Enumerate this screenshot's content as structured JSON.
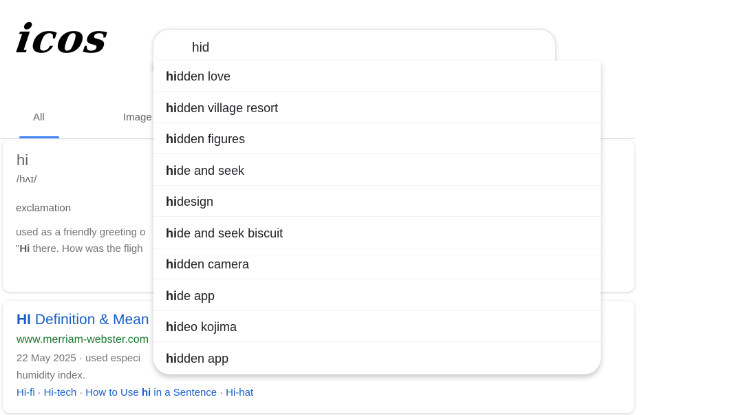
{
  "logo": {
    "text": "icos"
  },
  "search": {
    "value": "hid"
  },
  "tabs": [
    {
      "label": "All"
    },
    {
      "label": "Image"
    }
  ],
  "suggestions": [
    {
      "bold": "hi",
      "rest": "dden love"
    },
    {
      "bold": "hi",
      "rest": "dden village resort"
    },
    {
      "bold": "hi",
      "rest": "dden figures"
    },
    {
      "bold": "hi",
      "rest": "de and seek"
    },
    {
      "bold": "hi",
      "rest": "design"
    },
    {
      "bold": "hi",
      "rest": "de and seek biscuit"
    },
    {
      "bold": "hi",
      "rest": "dden camera"
    },
    {
      "bold": "hi",
      "rest": "de app"
    },
    {
      "bold": "hi",
      "rest": "deo kojima"
    },
    {
      "bold": "hi",
      "rest": "dden app"
    }
  ],
  "dictionary": {
    "word": "hi",
    "phonetic": "/hʌɪ/",
    "part_of_speech": "exclamation",
    "definition": "used as a friendly greeting o",
    "example_prefix": "\"",
    "example_bold": "Hi",
    "example_rest": " there. How was the fligh"
  },
  "merriam": {
    "title_bold": "HI",
    "title_rest": " Definition & Mean",
    "url": "www.merriam-webster.com",
    "snippet_line1": "22 May 2025 · used especi",
    "snippet_line2": "humidity index.",
    "links": [
      {
        "label": "Hi-fi"
      },
      {
        "label": "Hi-tech"
      },
      {
        "label_prefix": "How to Use ",
        "label_bold": "hi",
        "label_suffix": " in a Sentence"
      },
      {
        "label": "Hi-hat"
      }
    ],
    "separator": "·"
  }
}
